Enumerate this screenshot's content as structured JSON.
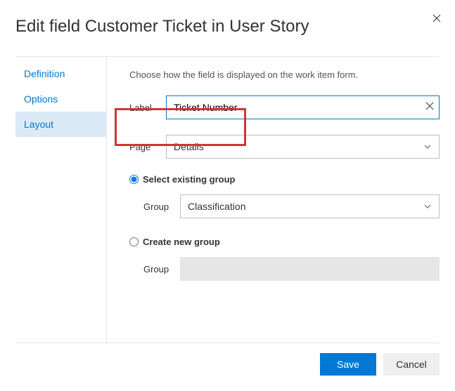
{
  "header": {
    "title": "Edit field Customer Ticket in User Story"
  },
  "tabs": {
    "definition": "Definition",
    "options": "Options",
    "layout": "Layout"
  },
  "content": {
    "description": "Choose how the field is displayed on the work item form.",
    "label_field_label": "Label",
    "label_value": "Ticket Number",
    "page_field_label": "Page",
    "page_value": "Details",
    "radio_existing": "Select existing group",
    "group_field_label": "Group",
    "group_value": "Classification",
    "radio_new": "Create new group",
    "group_field_label2": "Group",
    "new_group_value": ""
  },
  "footer": {
    "save": "Save",
    "cancel": "Cancel"
  }
}
